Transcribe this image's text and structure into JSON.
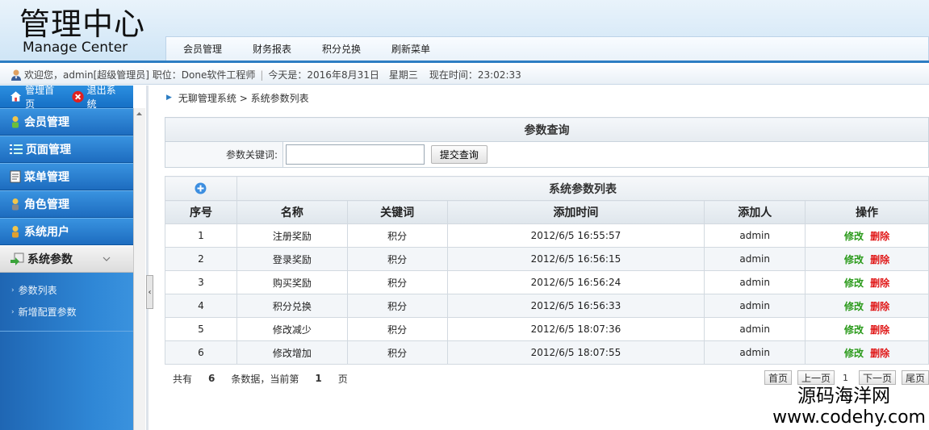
{
  "header": {
    "logo_cn": "管理中心",
    "logo_en": "Manage Center",
    "nav": [
      "会员管理",
      "财务报表",
      "积分兑换",
      "刷新菜单"
    ]
  },
  "infobar": {
    "welcome": "欢迎您，admin[超级管理员] 职位：Done软件工程师",
    "today": "今天是：2016年8月31日　星期三",
    "time": "现在时间：23:02:33"
  },
  "sidebar": {
    "home": "管理首页",
    "logout": "退出系统",
    "items": [
      "会员管理",
      "页面管理",
      "菜单管理",
      "角色管理",
      "系统用户",
      "系统参数"
    ],
    "submenu": [
      "参数列表",
      "新增配置参数"
    ]
  },
  "breadcrumb": "无聊管理系统 > 系统参数列表",
  "query": {
    "title": "参数查询",
    "label": "参数关键词:",
    "input_value": "",
    "submit": "提交查询"
  },
  "grid": {
    "title": "系统参数列表",
    "columns": [
      "序号",
      "名称",
      "关键词",
      "添加时间",
      "添加人",
      "操作"
    ],
    "rows": [
      [
        "1",
        "注册奖励",
        "积分",
        "2012/6/5 16:55:57",
        "admin"
      ],
      [
        "2",
        "登录奖励",
        "积分",
        "2012/6/5 16:56:15",
        "admin"
      ],
      [
        "3",
        "购买奖励",
        "积分",
        "2012/6/5 16:56:24",
        "admin"
      ],
      [
        "4",
        "积分兑换",
        "积分",
        "2012/6/5 16:56:33",
        "admin"
      ],
      [
        "5",
        "修改减少",
        "积分",
        "2012/6/5 18:07:36",
        "admin"
      ],
      [
        "6",
        "修改增加",
        "积分",
        "2012/6/5 18:07:55",
        "admin"
      ]
    ],
    "edit": "修改",
    "delete": "删除"
  },
  "pager": {
    "total_prefix": "共有",
    "total": "6",
    "middle": "条数据，当前第",
    "current": "1",
    "suffix": "页",
    "first": "首页",
    "prev": "上一页",
    "page_num": "1",
    "next": "下一页",
    "last": "尾页"
  },
  "watermark": {
    "cn": "源码海洋网",
    "en": "www.codehy.com"
  },
  "colors": {
    "accent": "#2c7dc3",
    "edit": "#2a9a1a",
    "delete": "#e01818"
  }
}
